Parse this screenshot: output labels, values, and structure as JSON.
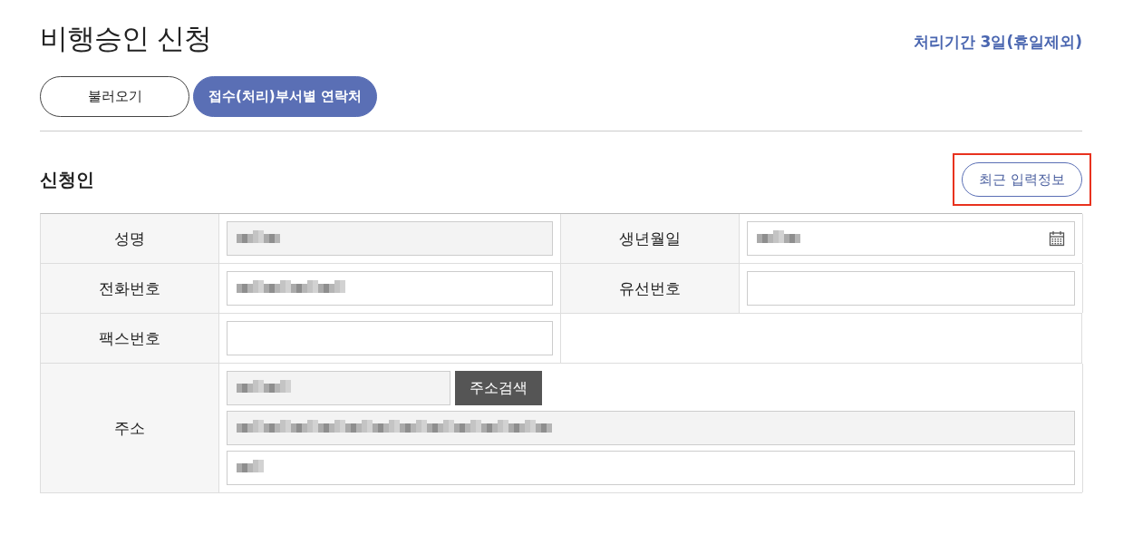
{
  "page": {
    "title": "비행승인 신청",
    "processing_period": "처리기간 3일(휴일제외)"
  },
  "top_buttons": [
    {
      "label": "불러오기",
      "selected": false
    },
    {
      "label": "접수(처리)부서별 연락처",
      "selected": true
    }
  ],
  "section": {
    "title": "신청인",
    "recent_button": {
      "label": "최근 입력정보",
      "highlighted": true
    }
  },
  "rows": [
    {
      "cells": [
        {
          "label": "성명",
          "field": {
            "kind": "text",
            "readonly": true,
            "redacted": true
          }
        },
        {
          "label": "생년월일",
          "field": {
            "kind": "date",
            "readonly": false,
            "redacted": true
          }
        }
      ]
    },
    {
      "cells": [
        {
          "label": "전화번호",
          "field": {
            "kind": "text",
            "readonly": false,
            "redacted": true
          }
        },
        {
          "label": "유선번호",
          "field": {
            "kind": "text",
            "readonly": false,
            "redacted": false
          }
        }
      ]
    },
    {
      "cells": [
        {
          "label": "팩스번호",
          "field": {
            "kind": "text",
            "readonly": false,
            "redacted": false
          }
        }
      ]
    }
  ],
  "address": {
    "label": "주소",
    "search_button": "주소검색",
    "fields": [
      {
        "kind": "zip",
        "readonly": true,
        "redacted": true
      },
      {
        "kind": "text",
        "readonly": true,
        "redacted": true
      },
      {
        "kind": "text",
        "readonly": false,
        "redacted": true
      }
    ]
  }
}
